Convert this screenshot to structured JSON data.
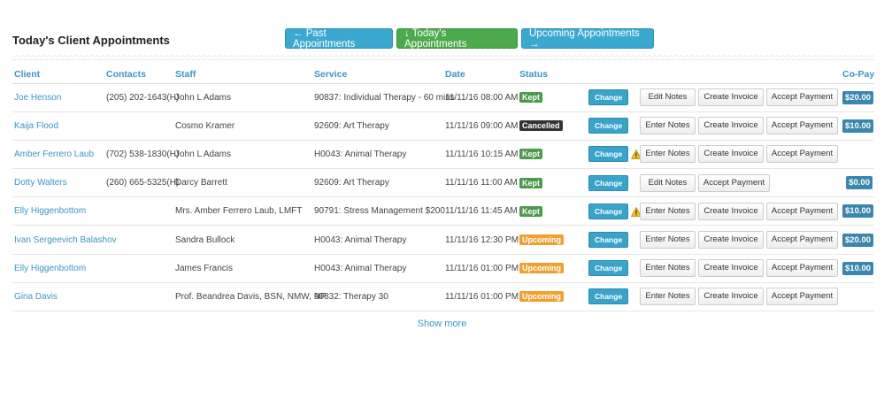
{
  "header": {
    "title": "Today's Client Appointments",
    "nav": {
      "past": "← Past Appointments",
      "today": "↓ Today's Appointments",
      "upcoming": "Upcoming Appointments →"
    }
  },
  "table": {
    "columns": {
      "client": "Client",
      "contacts": "Contacts",
      "staff": "Staff",
      "service": "Service",
      "date": "Date",
      "status": "Status",
      "copay": "Co-Pay"
    },
    "change_label": "Change",
    "rows": [
      {
        "client": "Joe Henson",
        "contacts": "(205) 202-1643(H)",
        "staff": "John L Adams",
        "service": "90837: Individual Therapy - 60 mins",
        "date": "11/11/16 08:00 AM",
        "status": "Kept",
        "status_kind": "kept",
        "warning": false,
        "actions": [
          "Edit Notes",
          "Create Invoice",
          "Accept Payment"
        ],
        "copay": "$20.00"
      },
      {
        "client": "Kaija Flood",
        "contacts": "",
        "staff": "Cosmo Kramer",
        "service": "92609: Art Therapy",
        "date": "11/11/16 09:00 AM",
        "status": "Cancelled",
        "status_kind": "cancelled",
        "warning": false,
        "actions": [
          "Enter Notes",
          "Create Invoice",
          "Accept Payment"
        ],
        "copay": "$10.00"
      },
      {
        "client": "Amber Ferrero Laub",
        "contacts": "(702) 538-1830(H)",
        "staff": "John L Adams",
        "service": "H0043: Animal Therapy",
        "date": "11/11/16 10:15 AM",
        "status": "Kept",
        "status_kind": "kept",
        "warning": true,
        "actions": [
          "Enter Notes",
          "Create Invoice",
          "Accept Payment"
        ],
        "copay": ""
      },
      {
        "client": "Dotty Walters",
        "contacts": "(260) 665-5325(H)",
        "staff": "Darcy Barrett",
        "service": "92609: Art Therapy",
        "date": "11/11/16 11:00 AM",
        "status": "Kept",
        "status_kind": "kept",
        "warning": false,
        "actions": [
          "Edit Notes",
          "Accept Payment"
        ],
        "copay": "$0.00"
      },
      {
        "client": "Elly Higgenbottom",
        "contacts": "",
        "staff": "Mrs. Amber Ferrero Laub, LMFT",
        "service": "90791: Stress Management $200",
        "date": "11/11/16 11:45 AM",
        "status": "Kept",
        "status_kind": "kept",
        "warning": true,
        "actions": [
          "Enter Notes",
          "Create Invoice",
          "Accept Payment"
        ],
        "copay": "$10.00"
      },
      {
        "client": "Ivan Sergeevich Balashov",
        "contacts": "",
        "staff": "Sandra Bullock",
        "service": "H0043: Animal Therapy",
        "date": "11/11/16 12:30 PM",
        "status": "Upcoming",
        "status_kind": "upcoming",
        "warning": false,
        "actions": [
          "Enter Notes",
          "Create Invoice",
          "Accept Payment"
        ],
        "copay": "$20.00"
      },
      {
        "client": "Elly Higgenbottom",
        "contacts": "",
        "staff": "James Francis",
        "service": "H0043: Animal Therapy",
        "date": "11/11/16 01:00 PM",
        "status": "Upcoming",
        "status_kind": "upcoming",
        "warning": false,
        "actions": [
          "Enter Notes",
          "Create Invoice",
          "Accept Payment"
        ],
        "copay": "$10.00"
      },
      {
        "client": "Gina Davis",
        "contacts": "",
        "staff": "Prof. Beandrea Davis, BSN, NMW, NP",
        "service": "90832: Therapy 30",
        "date": "11/11/16 01:00 PM",
        "status": "Upcoming",
        "status_kind": "upcoming",
        "warning": false,
        "actions": [
          "Enter Notes",
          "Create Invoice",
          "Accept Payment"
        ],
        "copay": ""
      }
    ]
  },
  "footer": {
    "show_more": "Show more"
  },
  "colors": {
    "link": "#3a97c4",
    "kept": "#4d9a4d",
    "cancelled": "#333333",
    "upcoming": "#f0a030",
    "copay": "#3a86ad",
    "warning": "#f0c020"
  }
}
